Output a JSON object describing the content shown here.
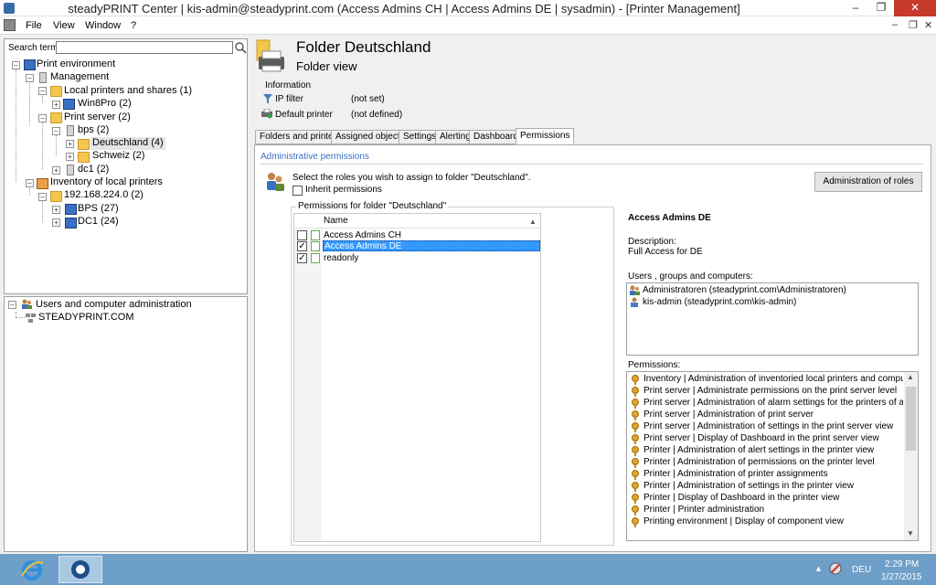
{
  "window": {
    "title": "steadyPRINT Center | kis-admin@steadyprint.com (Access Admins CH | Access Admins DE | sysadmin) - [Printer Management]"
  },
  "menu": {
    "file": "File",
    "view": "View",
    "window": "Window",
    "help": "?"
  },
  "search": {
    "label": "Search term",
    "value": ""
  },
  "tree": {
    "root": "Print environment",
    "management": "Management",
    "local_printers": "Local printers and shares (1)",
    "win8pro": "Win8Pro (2)",
    "print_server": "Print server (2)",
    "bps": "bps (2)",
    "deutschland": "Deutschland (4)",
    "schweiz": "Schweiz (2)",
    "dc1": "dc1 (2)",
    "inventory": "Inventory of local printers",
    "subnet": "192.168.224.0 (2)",
    "bps_inv": "BPS (27)",
    "dc1_inv": "DC1 (24)"
  },
  "users_tree": {
    "root": "Users and  computer administration",
    "domain": "STEADYPRINT.COM"
  },
  "header": {
    "title": "Folder Deutschland",
    "subtitle": "Folder view"
  },
  "info": {
    "title": "Information",
    "ip_filter_label": "IP filter",
    "ip_filter_value": "(not set)",
    "default_printer_label": "Default printer",
    "default_printer_value": "(not defined)"
  },
  "tabs": [
    "Folders and printers",
    "Assigned objects",
    "Settings",
    "Alerting",
    "Dashboard",
    "Permissions"
  ],
  "permissions": {
    "section_title": "Administrative permissions",
    "instruction": "Select the roles you wish to assign to folder \"Deutschland\".",
    "inherit_label": "Inherit permissions",
    "admin_roles_button": "Administration of roles",
    "group_title": "Permissions for folder \"Deutschland\"",
    "column_name": "Name",
    "roles": [
      {
        "name": "Access Admins CH",
        "checked": false
      },
      {
        "name": "Access Admins DE",
        "checked": true
      },
      {
        "name": "readonly",
        "checked": true
      }
    ],
    "selected_role": "Access Admins DE",
    "description_label": "Description:",
    "description_value": "Full Access for DE",
    "users_label": "Users , groups and computers:",
    "users": [
      "Administratoren (steadyprint.com\\Administratoren)",
      "kis-admin (steadyprint.com\\kis-admin)"
    ],
    "permissions_label": "Permissions:",
    "permission_items": [
      "Inventory | Administration of inventoried local printers and compu",
      "Print server | Administrate permissions on the print server level",
      "Print server | Administration of alarm settings for the printers of a",
      "Print server | Administration of print server",
      "Print server | Administration of settings in the print server view",
      "Print server | Display of Dashboard in the print server view",
      "Printer | Administration of alert settings in the printer view",
      "Printer | Administration of permissions on the printer level",
      "Printer | Administration of printer assignments",
      "Printer | Administration of settings in the printer view",
      "Printer | Display of Dashboard in the printer view",
      "Printer | Printer administration",
      "Printing environment | Display of component view"
    ]
  },
  "taskbar": {
    "lang": "DEU",
    "time": "2:29 PM",
    "date": "1/27/2015"
  }
}
